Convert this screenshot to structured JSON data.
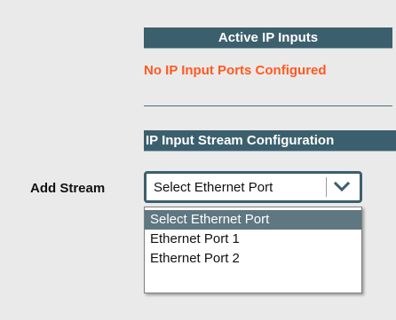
{
  "active_ip_inputs": {
    "header": "Active IP Inputs",
    "status_message": "No IP Input Ports Configured"
  },
  "stream_config": {
    "header": "IP Input Stream Configuration",
    "add_stream_label": "Add Stream",
    "select": {
      "value": "Select Ethernet Port",
      "options": [
        "Select Ethernet Port",
        "Ethernet Port 1",
        "Ethernet Port 2"
      ],
      "highlighted_index": 0,
      "expanded": true
    }
  },
  "icons": {
    "dropdown_arrow": "chevron-down-icon"
  },
  "colors": {
    "header_bg": "#3c5f6e",
    "status_text": "#ff5a1f",
    "page_bg": "#eaeaea",
    "highlight_bg": "#5e7781"
  }
}
